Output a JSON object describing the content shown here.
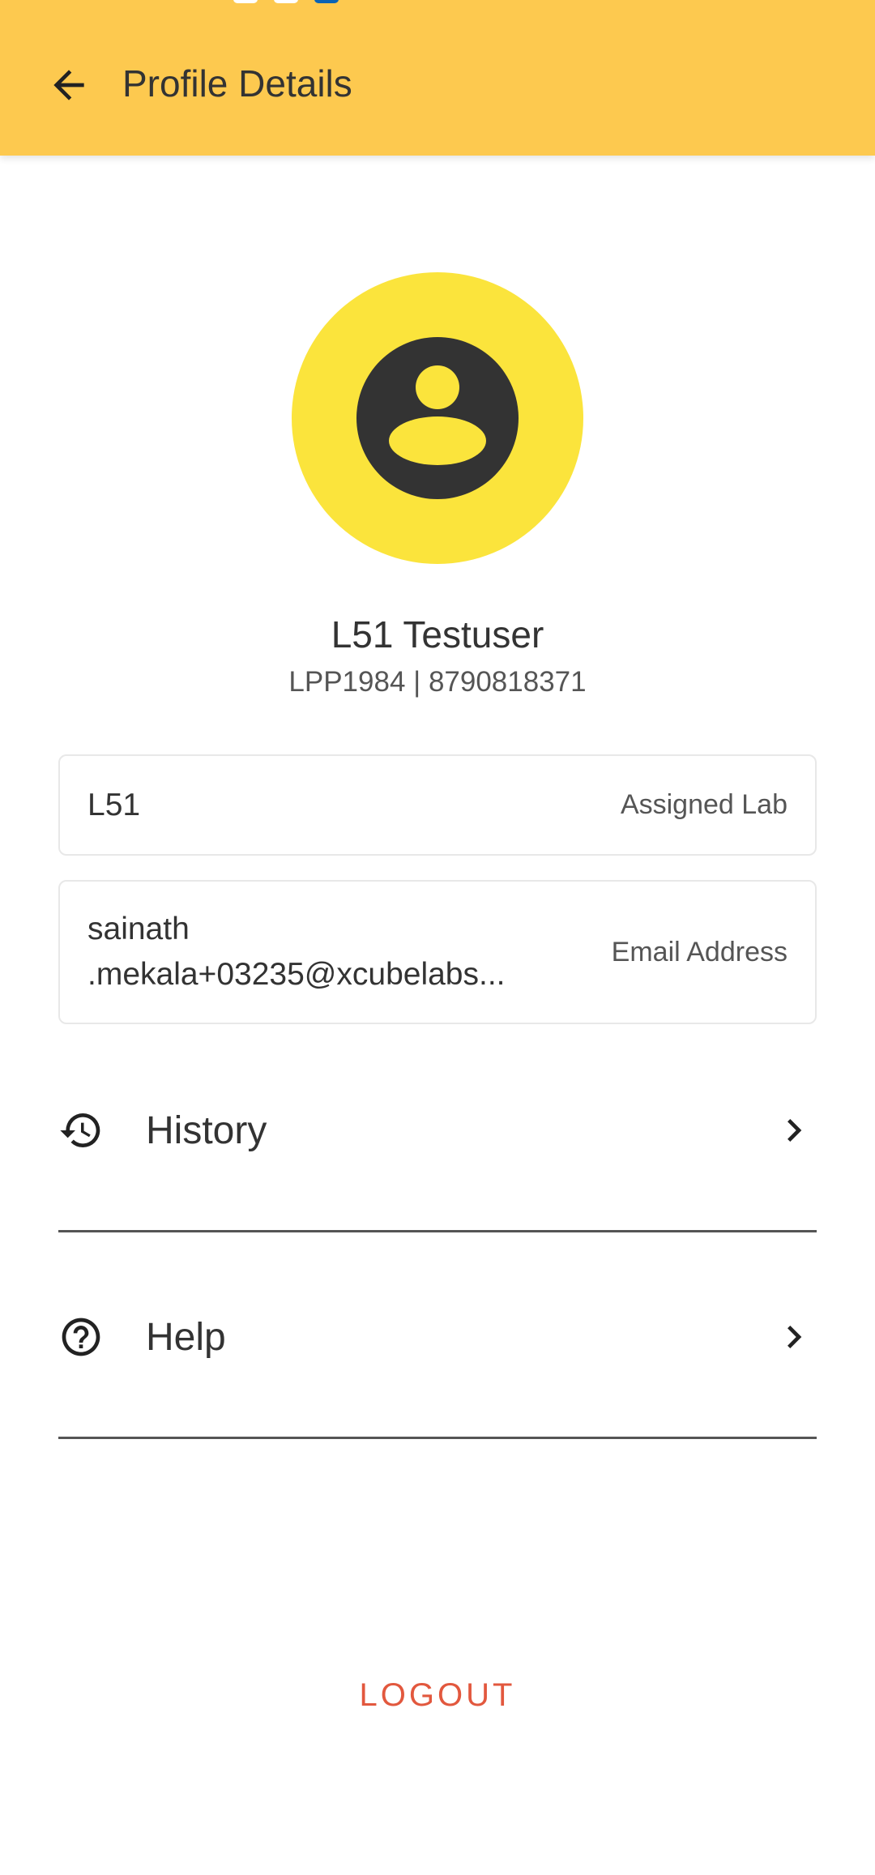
{
  "appbar": {
    "title": "Profile Details",
    "back_icon": "arrow-left-icon",
    "color": "#FDC94F"
  },
  "profile": {
    "avatar_icon": "account-circle-icon",
    "avatar_bg": "#FBE43C",
    "name": "L51 Testuser",
    "subtitle": "LPP1984 | 8790818371"
  },
  "fields": {
    "lab": {
      "value": "L51",
      "label": "Assigned Lab"
    },
    "email": {
      "value_line1": "sainath",
      "value_line2": ".mekala+03235@xcubelabs...",
      "label": "Email Address"
    }
  },
  "menu": {
    "history": {
      "label": "History",
      "icon": "history-icon"
    },
    "help": {
      "label": "Help",
      "icon": "help-circle-icon"
    }
  },
  "logout": {
    "label": "LOGOUT",
    "color": "#E2583E"
  }
}
